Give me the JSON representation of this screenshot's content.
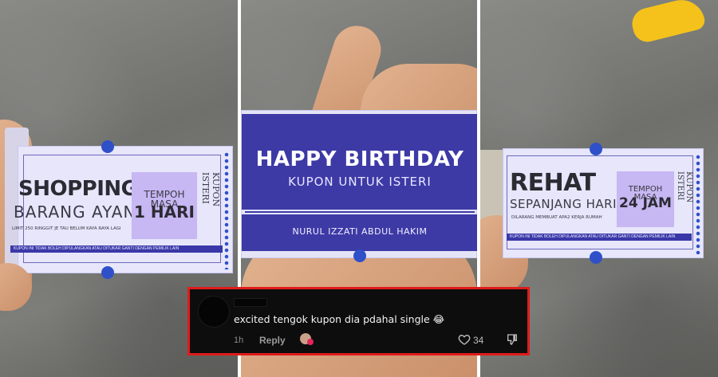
{
  "coupons": {
    "left": {
      "title": "SHOPPING",
      "subtitle": "BARANG AYANG",
      "fine_print": "LIMIT 250 RINGGIT JE TAU BELUM KAYA RAYA LAGI",
      "box_label": "TEMPOH MASA",
      "box_value": "1 HARI",
      "side_label": "KUPON ISTERI",
      "footer": "KUPON INI TIDAK BOLEH DIPULANGKAN ATAU DITUKAR GANTI DENGAN PEMILIK LAIN"
    },
    "center": {
      "title": "HAPPY BIRTHDAY",
      "subtitle": "KUPON UNTUK ISTERI",
      "name": "NURUL IZZATI ABDUL HAKIM"
    },
    "right": {
      "title": "REHAT",
      "subtitle": "SEPANJANG HARI",
      "fine_print": "DILARANG MEMBUAT APA2 KERJA RUMAH",
      "box_label": "TEMPOH MASA",
      "box_value": "24 JAM",
      "side_label": "KUPON ISTERI",
      "footer": "KUPON INI TIDAK BOLEH DIPULANGKAN ATAU DITUKAR GANTI DENGAN PEMILIK LAIN"
    }
  },
  "comment": {
    "text": "excited tengok kupon dia pdahal single 😂",
    "time": "1h",
    "reply_label": "Reply",
    "like_count": "34",
    "icons": [
      "heart-icon",
      "dislike-icon",
      "reaction-avatar-icon"
    ]
  },
  "colors": {
    "coupon_bg": "#e7e6fb",
    "coupon_blue": "#2f50c9",
    "birthday_bg": "#3d3aa6",
    "box_purple": "#c7b7f2",
    "comment_border": "#e01b1b"
  }
}
